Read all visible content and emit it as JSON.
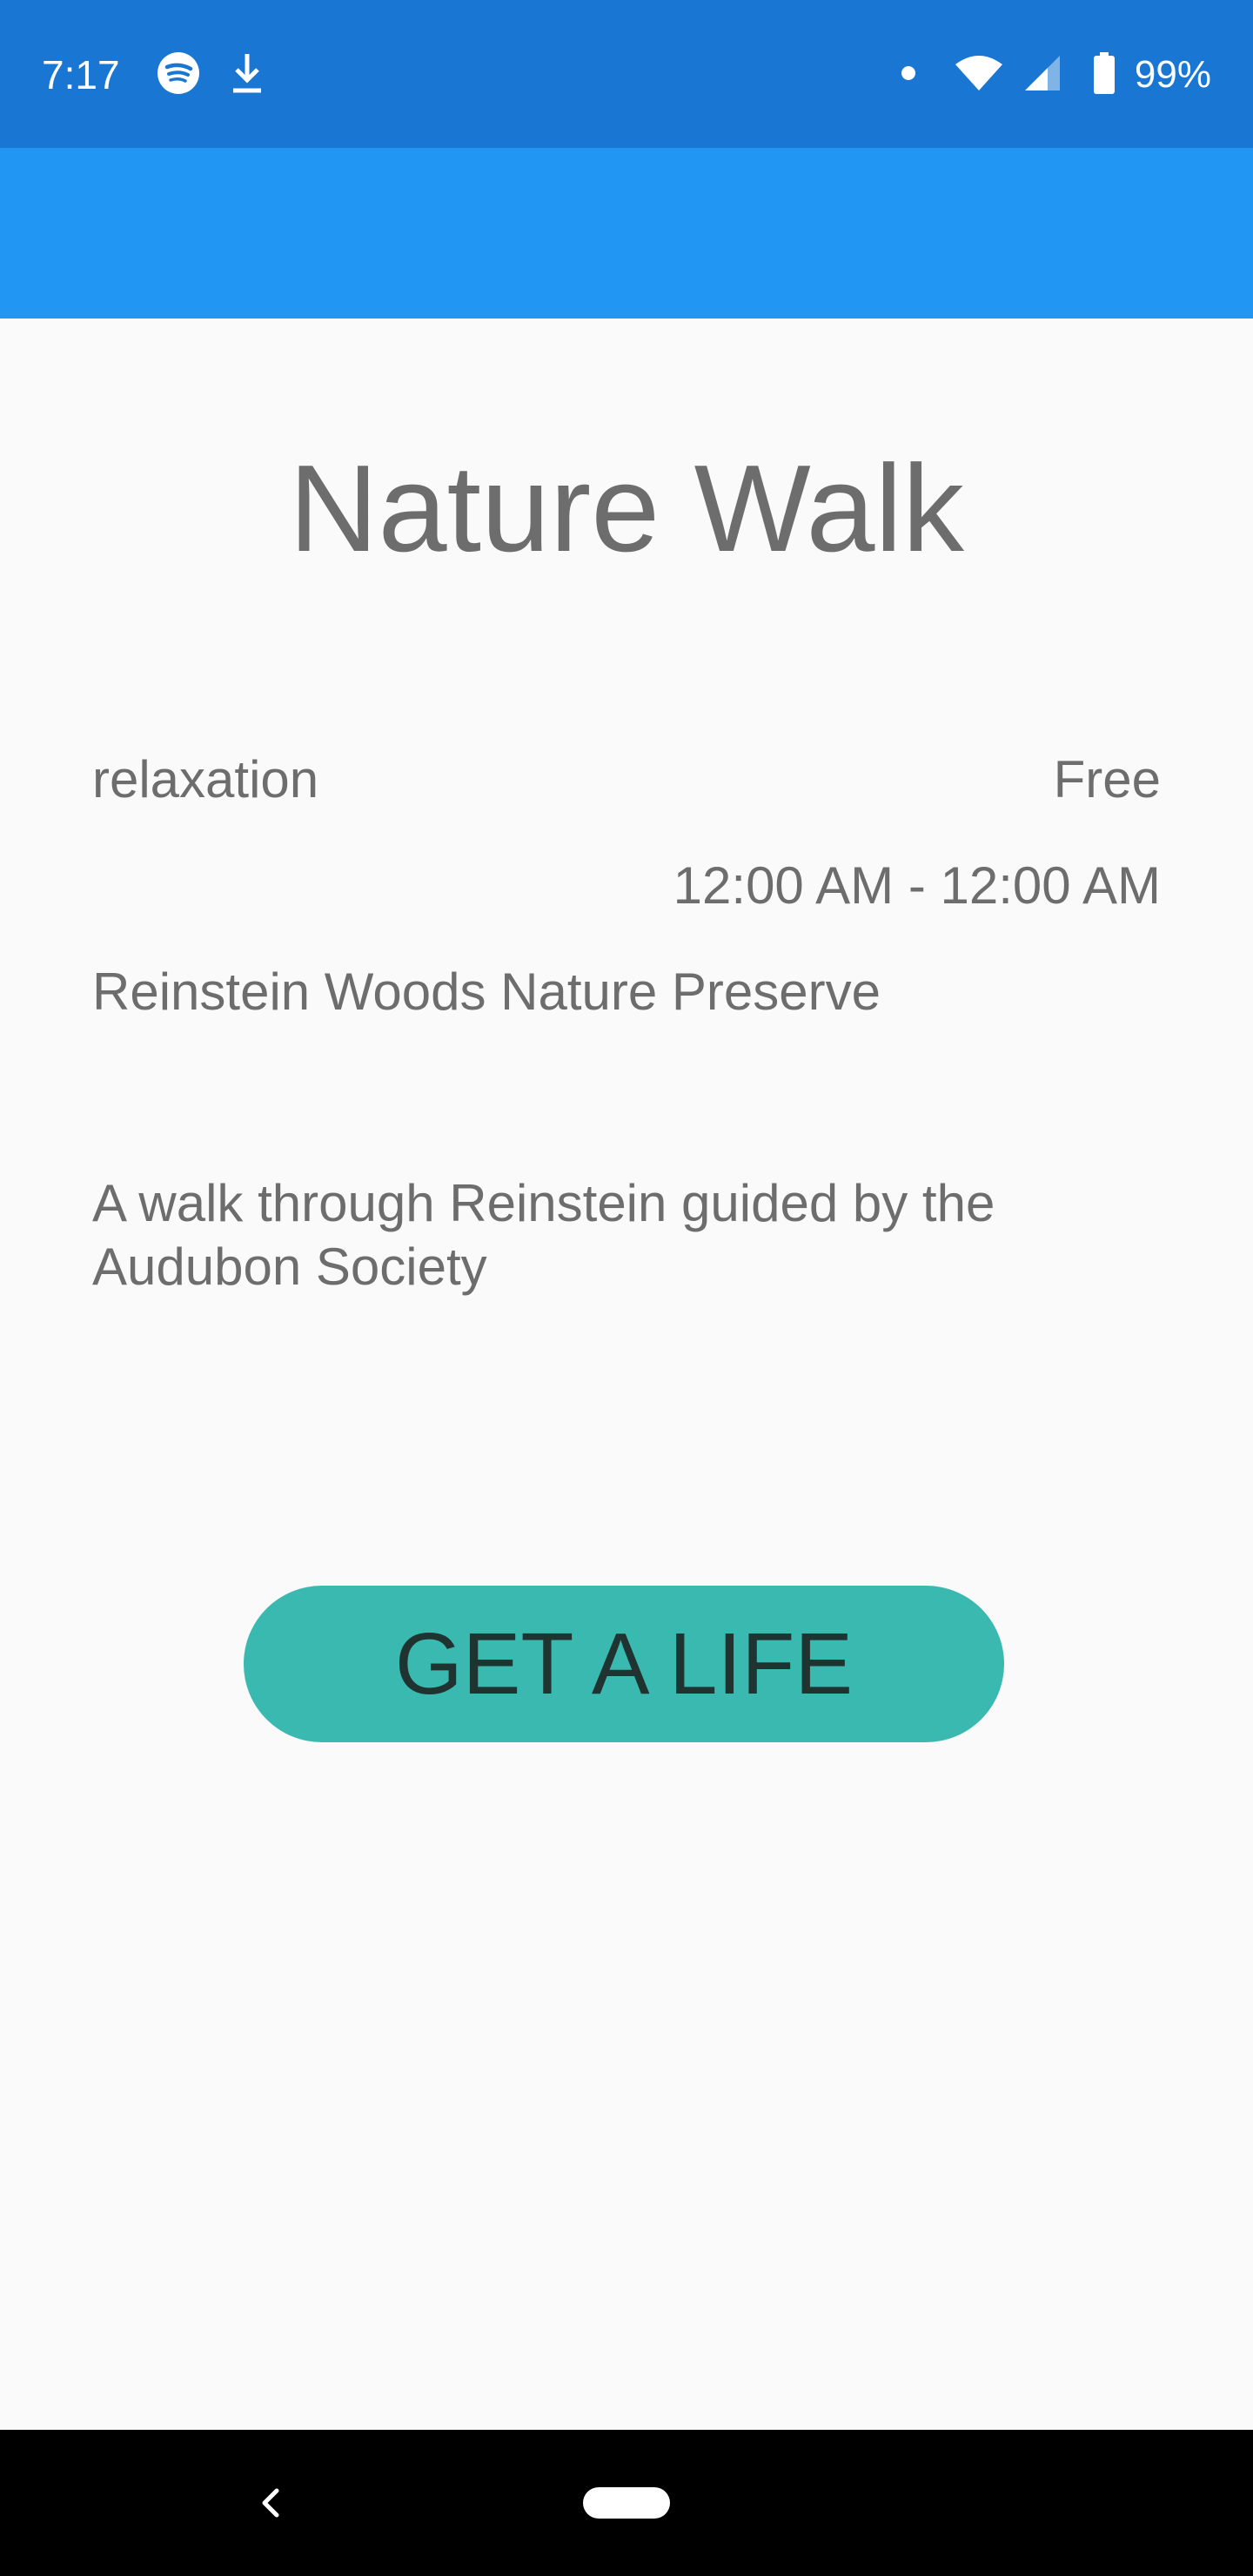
{
  "status_bar": {
    "time": "7:17",
    "battery": "99%",
    "icons_left": [
      "spotify-icon",
      "download-icon"
    ],
    "icons_right": [
      "notification-dot-icon",
      "wifi-icon",
      "cell-signal-icon",
      "battery-icon"
    ]
  },
  "event": {
    "title": "Nature Walk",
    "category": "relaxation",
    "price": "Free",
    "time_range": "12:00 AM - 12:00 AM",
    "location": "Reinstein Woods Nature Preserve",
    "description": "A walk through Reinstein guided by the Audubon Society"
  },
  "actions": {
    "cta_label": "GET A LIFE"
  },
  "nav_bar": {
    "icons": [
      "back-icon",
      "home-pill-icon"
    ]
  },
  "colors": {
    "status_bar": "#1976d2",
    "app_bar": "#2196f3",
    "background": "#fafafa",
    "text": "#6d6d6d",
    "button": "#3ab9b1",
    "button_text": "#1f3330"
  }
}
